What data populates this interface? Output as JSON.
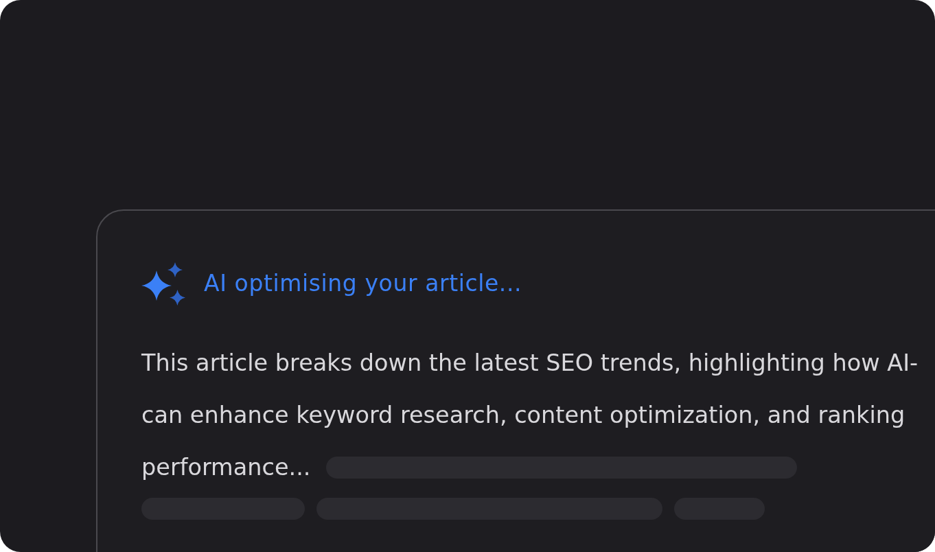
{
  "status": {
    "text": "AI optimising your article..."
  },
  "summary": {
    "lines": [
      "This article breaks down the latest SEO trends, highlighting how AI-",
      "can enhance keyword research, content optimization, and ranking",
      "performance..."
    ],
    "loading": true
  }
}
